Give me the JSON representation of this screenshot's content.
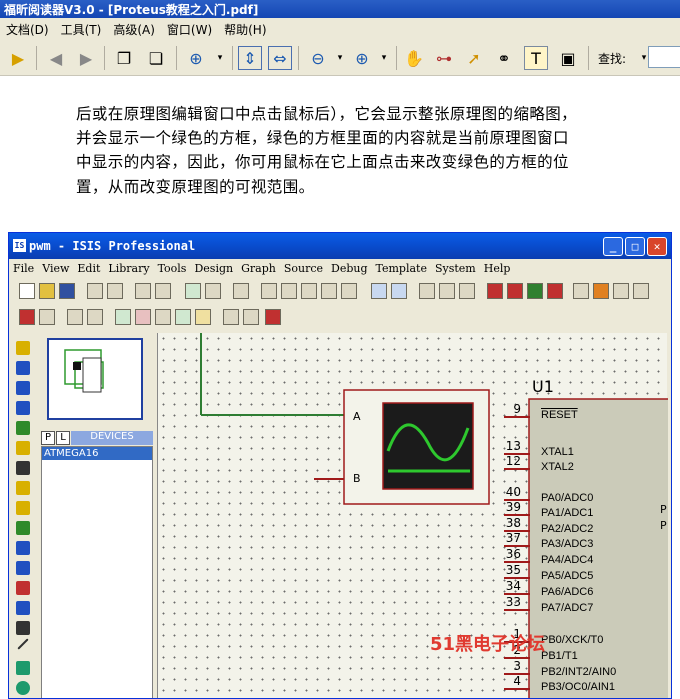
{
  "app": {
    "title": "福昕阅读器V3.0 - [Proteus教程之入门.pdf]"
  },
  "menu": [
    "文档(D)",
    "工具(T)",
    "高级(A)",
    "窗口(W)",
    "帮助(H)"
  ],
  "toolbar": {
    "find_label": "查找:",
    "find_value": ""
  },
  "doc": {
    "lines": [
      "后或在原理图编辑窗口中点击鼠标后），它会显示整张原理图的缩略图，",
      "并会显示一个绿色的方框，绿色的方框里面的内容就是当前原理图窗口",
      "中显示的内容，因此，你可用鼠标在它上面点击来改变绿色的方框的位",
      "置，从而改变原理图的可视范围。"
    ]
  },
  "isis": {
    "title": "pwm - ISIS Professional",
    "menu": [
      "File",
      "View",
      "Edit",
      "Library",
      "Tools",
      "Design",
      "Graph",
      "Source",
      "Debug",
      "Template",
      "System",
      "Help"
    ],
    "devices_tabs": [
      "P",
      "L"
    ],
    "devices_label": "DEVICES",
    "devices": [
      "ATMEGA16"
    ],
    "scope": {
      "in_a": "A",
      "in_b": "B"
    },
    "chip": {
      "ref": "U1",
      "pins": [
        {
          "num": "9",
          "name": "RESET"
        },
        {
          "num": "13",
          "name": "XTAL1"
        },
        {
          "num": "12",
          "name": "XTAL2"
        },
        {
          "num": "40",
          "name": "PA0/ADC0"
        },
        {
          "num": "39",
          "name": "PA1/ADC1"
        },
        {
          "num": "38",
          "name": "PA2/ADC2"
        },
        {
          "num": "37",
          "name": "PA3/ADC3"
        },
        {
          "num": "36",
          "name": "PA4/ADC4"
        },
        {
          "num": "35",
          "name": "PA5/ADC5"
        },
        {
          "num": "34",
          "name": "PA6/ADC6"
        },
        {
          "num": "33",
          "name": "PA7/ADC7"
        },
        {
          "num": "1",
          "name": "PB0/XCK/T0"
        },
        {
          "num": "2",
          "name": "PB1/T1"
        },
        {
          "num": "3",
          "name": "PB2/INT2/AIN0"
        },
        {
          "num": "4",
          "name": "PB3/OC0/AIN1"
        }
      ],
      "right_marks": [
        "P",
        "P"
      ]
    }
  },
  "watermark": "51黑电子论坛",
  "colors": {
    "accent": "#1446b3",
    "grid_bg": "#f3f3ea",
    "wire": "#2e7d32",
    "chip": "#a01a1a"
  }
}
